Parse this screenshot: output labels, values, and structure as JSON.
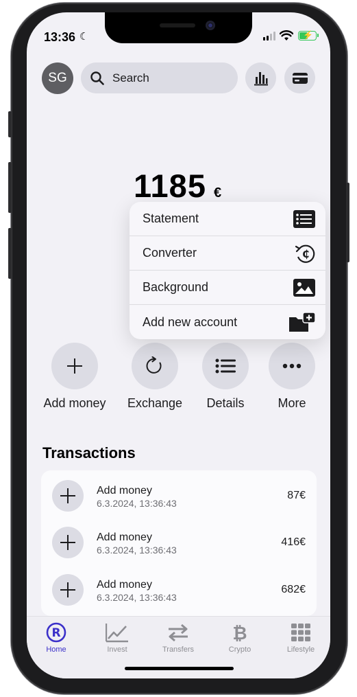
{
  "status_bar": {
    "time": "13:36",
    "moon": "☾"
  },
  "header": {
    "avatar_initials": "SG",
    "search_placeholder": "Search",
    "chart_button": "bar-chart-icon",
    "card_button": "card-icon"
  },
  "balance": {
    "amount": "1185",
    "currency": "€"
  },
  "context_menu": {
    "items": [
      {
        "label": "Statement",
        "icon": "list-icon"
      },
      {
        "label": "Converter",
        "icon": "currency-convert-icon"
      },
      {
        "label": "Background",
        "icon": "image-icon"
      },
      {
        "label": "Add new account",
        "icon": "folder-add-icon"
      }
    ]
  },
  "actions": [
    {
      "label": "Add money",
      "icon": "plus-icon"
    },
    {
      "label": "Exchange",
      "icon": "refresh-icon"
    },
    {
      "label": "Details",
      "icon": "list-icon"
    },
    {
      "label": "More",
      "icon": "ellipsis-icon"
    }
  ],
  "transactions": {
    "title": "Transactions",
    "items": [
      {
        "name": "Add money",
        "date": "6.3.2024, 13:36:43",
        "amount": "87€"
      },
      {
        "name": "Add money",
        "date": "6.3.2024, 13:36:43",
        "amount": "416€"
      },
      {
        "name": "Add money",
        "date": "6.3.2024, 13:36:43",
        "amount": "682€"
      }
    ]
  },
  "tabbar": {
    "tabs": [
      {
        "label": "Home",
        "active": true
      },
      {
        "label": "Invest"
      },
      {
        "label": "Transfers"
      },
      {
        "label": "Crypto"
      },
      {
        "label": "Lifestyle"
      }
    ]
  },
  "colors": {
    "accent": "#3b30c9",
    "battery": "#34c759",
    "background": "#f2f1f6"
  }
}
